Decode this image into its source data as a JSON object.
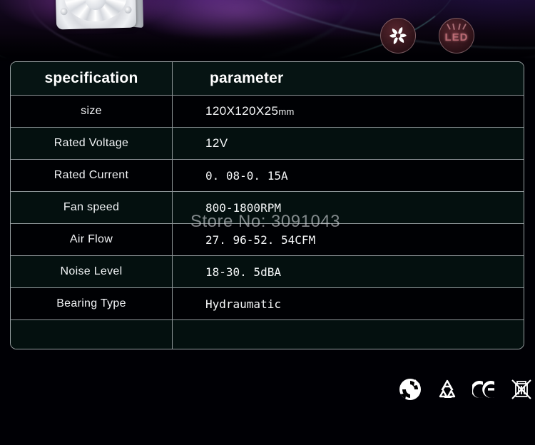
{
  "product": {
    "photo_alt": "white-120mm-case-fan",
    "badges": [
      {
        "name": "fan-badge",
        "icon": "fan-blade-icon",
        "label": ""
      },
      {
        "name": "led-badge",
        "icon": "led-glow-icon",
        "label": "LED"
      }
    ]
  },
  "table": {
    "header": {
      "spec_label": "specification",
      "param_label": "parameter"
    },
    "rows": [
      {
        "spec": "size",
        "param": "120X120X25",
        "unit": "mm"
      },
      {
        "spec": "Rated Voltage",
        "param": "12V",
        "unit": ""
      },
      {
        "spec": "Rated Current",
        "param": "0. 08-0. 15A",
        "unit": ""
      },
      {
        "spec": "Fan speed",
        "param": "800-1800RPM",
        "unit": ""
      },
      {
        "spec": "Air Flow",
        "param": "27. 96-52. 54CFM",
        "unit": ""
      },
      {
        "spec": "Noise Level",
        "param": "18-30. 5dBA",
        "unit": ""
      },
      {
        "spec": "Bearing Type",
        "param": "Hydraumatic",
        "unit": ""
      }
    ]
  },
  "watermark": {
    "text": "Store No: 3091043"
  },
  "certifications": [
    {
      "name": "green-dot-icon",
      "label": "Green Dot"
    },
    {
      "name": "recycling-icon",
      "label": "Recycling"
    },
    {
      "name": "ce-mark-icon",
      "label": "CE"
    },
    {
      "name": "weee-crossed-bin-icon",
      "label": "WEEE"
    }
  ],
  "colors": {
    "table_border": "#9aa2a4",
    "row_alt": "#04100f",
    "row_plain": "#000104",
    "text": "#f5f7f8",
    "badge_tint": "#5c2830",
    "accent_purple": "#8a3cb4",
    "accent_teal": "#78dcd2"
  }
}
